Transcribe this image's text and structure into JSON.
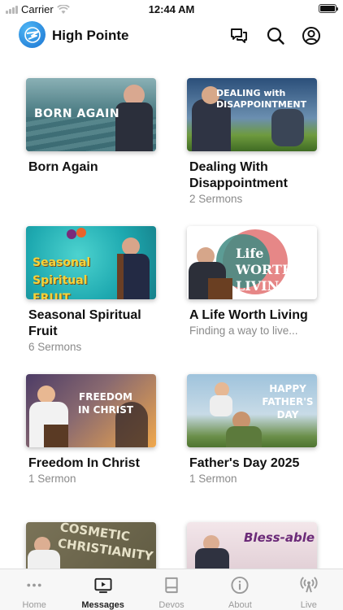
{
  "status_bar": {
    "carrier": "Carrier",
    "time": "12:44 AM"
  },
  "header": {
    "app_title": "High Pointe"
  },
  "cards": [
    {
      "title": "Born Again",
      "subtitle": "",
      "thumb_text": "BORN AGAIN"
    },
    {
      "title": "Dealing With Disappointment",
      "subtitle": "2 Sermons",
      "thumb_text": "DEALING with DISAPPOINTMENT"
    },
    {
      "title": "Seasonal Spiritual Fruit",
      "subtitle": "6 Sermons",
      "thumb_text": "Seasonal Spiritual FRUIT"
    },
    {
      "title": "A Life Worth Living",
      "subtitle": "Finding a way to live...",
      "thumb_text": "Life WORTH LIVING"
    },
    {
      "title": "Freedom In Christ",
      "subtitle": "1 Sermon",
      "thumb_text": "FREEDOM IN CHRIST"
    },
    {
      "title": "Father's Day 2025",
      "subtitle": "1 Sermon",
      "thumb_text": "HAPPY FATHER'S DAY"
    },
    {
      "title": "",
      "subtitle": "",
      "thumb_text": "COSMETIC CHRISTIANITY"
    },
    {
      "title": "",
      "subtitle": "",
      "thumb_text": "Bless-able"
    }
  ],
  "tabs": [
    {
      "label": "Home",
      "icon": "more-dots-icon"
    },
    {
      "label": "Messages",
      "icon": "video-icon"
    },
    {
      "label": "Devos",
      "icon": "book-icon"
    },
    {
      "label": "About",
      "icon": "info-icon"
    },
    {
      "label": "Live",
      "icon": "broadcast-icon"
    }
  ],
  "active_tab": "Messages",
  "colors": {
    "brand_blue": "#1a73d1",
    "active_tab": "#222222",
    "inactive_tab": "#9a9a9a"
  }
}
